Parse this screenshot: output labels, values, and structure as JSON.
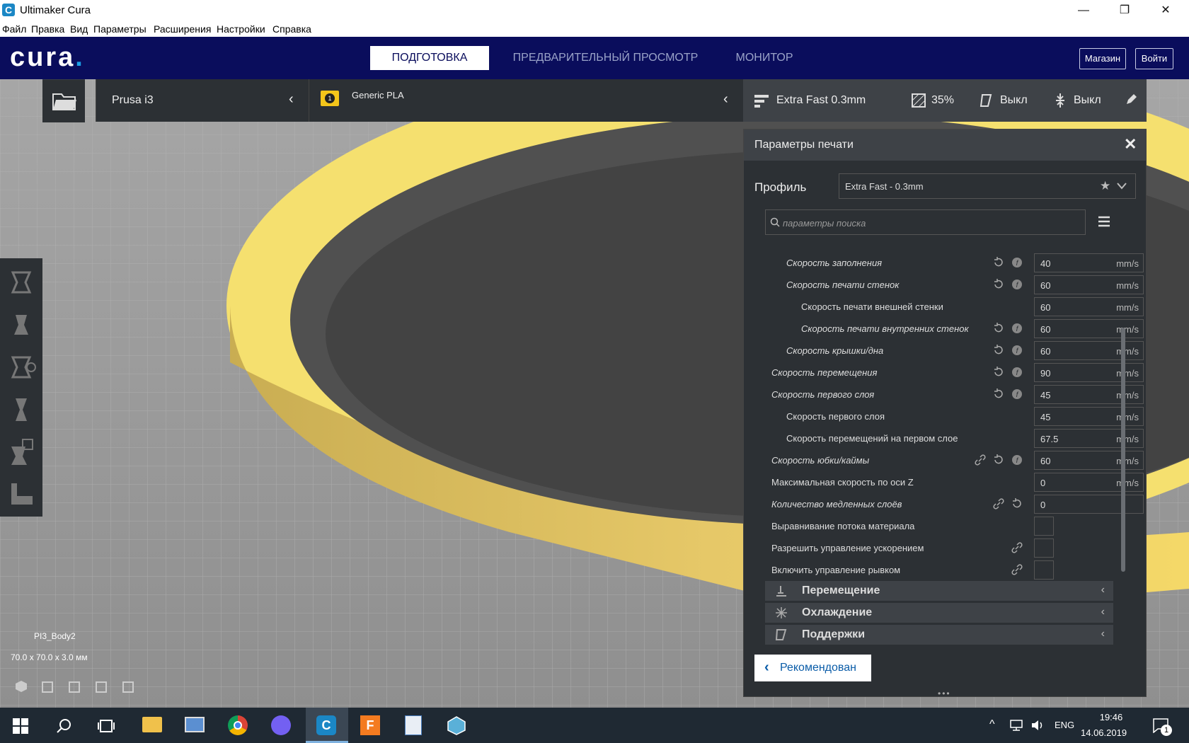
{
  "window": {
    "title": "Ultimaker Cura",
    "minimize": "—",
    "maximize": "❐",
    "close": "✕"
  },
  "menu": {
    "items": [
      "Файл",
      "Правка",
      "Вид",
      "Параметры",
      "Расширения",
      "Настройки",
      "Справка"
    ]
  },
  "header": {
    "logo": "cura",
    "logo_dot": ".",
    "tabs": {
      "prepare": "ПОДГОТОВКА",
      "preview": "ПРЕДВАРИТЕЛЬНЫЙ ПРОСМОТР",
      "monitor": "МОНИТОР"
    },
    "shop": "Магазин",
    "login": "Войти"
  },
  "toolbar": {
    "printer": "Prusa i3",
    "extruder_number": "1",
    "material": "Generic PLA",
    "profile": "Extra Fast 0.3mm",
    "infill": "35%",
    "support": "Выкл",
    "adhesion": "Выкл"
  },
  "panel": {
    "title": "Параметры печати",
    "close": "✕",
    "profile_label": "Профиль",
    "profile_value": "Extra Fast - 0.3mm",
    "search_placeholder": "параметры поиска",
    "settings": [
      {
        "label": "Скорость заполнения",
        "value": "40",
        "unit": "mm/s"
      },
      {
        "label": "Скорость печати стенок",
        "value": "60",
        "unit": "mm/s"
      },
      {
        "label": "Скорость печати внешней стенки",
        "value": "60",
        "unit": "mm/s"
      },
      {
        "label": "Скорость печати внутренних стенок",
        "value": "60",
        "unit": "mm/s"
      },
      {
        "label": "Скорость крышки/дна",
        "value": "60",
        "unit": "mm/s"
      },
      {
        "label": "Скорость перемещения",
        "value": "90",
        "unit": "mm/s"
      },
      {
        "label": "Скорость первого слоя",
        "value": "45",
        "unit": "mm/s"
      },
      {
        "label": "Скорость первого слоя",
        "value": "45",
        "unit": "mm/s"
      },
      {
        "label": "Скорость перемещений на первом слое",
        "value": "67.5",
        "unit": "mm/s"
      },
      {
        "label": "Скорость юбки/каймы",
        "value": "60",
        "unit": "mm/s"
      },
      {
        "label": "Максимальная скорость по оси Z",
        "value": "0",
        "unit": "mm/s"
      },
      {
        "label": "Количество медленных слоёв",
        "value": "0",
        "unit": ""
      },
      {
        "label": "Выравнивание потока материала"
      },
      {
        "label": "Разрешить управление ускорением"
      },
      {
        "label": "Включить управление рывком"
      }
    ],
    "categories": [
      "Перемещение",
      "Охлаждение",
      "Поддержки"
    ],
    "recommended": "Рекомендован"
  },
  "model": {
    "name": "PI3_Body2",
    "dims": "70.0 x 70.0 x 3.0 мм"
  },
  "taskbar": {
    "lang": "ENG",
    "time": "19:46",
    "date": "14.06.2019",
    "notifications": "1"
  },
  "colors": {
    "header": "#0a0d5c",
    "panel": "#2c3034",
    "model": "#f5d65f",
    "accent": "#1b87c5"
  }
}
